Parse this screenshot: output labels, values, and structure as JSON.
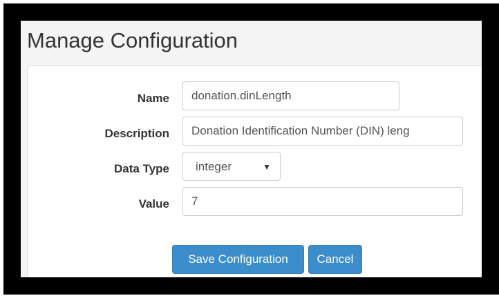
{
  "page": {
    "title": "Manage Configuration"
  },
  "form": {
    "name_label": "Name",
    "name_value": "donation.dinLength",
    "description_label": "Description",
    "description_value": "Donation Identification Number (DIN) leng",
    "data_type_label": "Data Type",
    "data_type_value": "integer",
    "value_label": "Value",
    "value_value": "7"
  },
  "actions": {
    "save_label": "Save Configuration",
    "cancel_label": "Cancel"
  },
  "icons": {
    "select_arrow": "chevron-down-icon"
  },
  "colors": {
    "primary": "#3c8dcb",
    "frame": "#000000",
    "page_background": "#f4f4f4"
  }
}
